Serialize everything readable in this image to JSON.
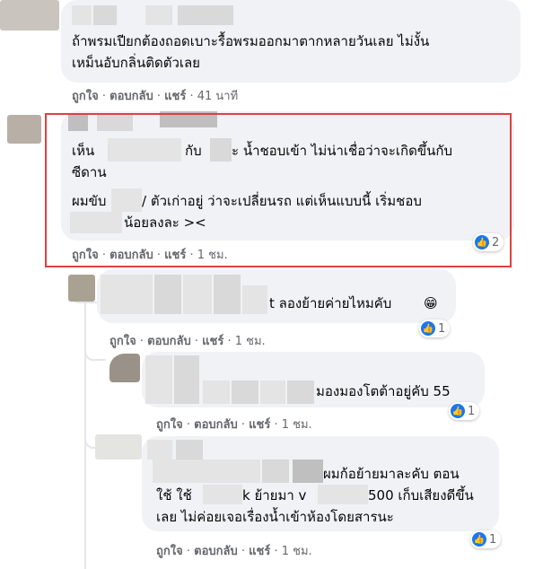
{
  "comments": [
    {
      "lines": [
        "ถ้าพรมเปียกต้องถอดเบาะรื้อพรมออกมาตากหลายวันเลย ไม่งั้น",
        "เหม็นอับกลิ่นติดตัวเลย"
      ],
      "actions": {
        "like": "ถูกใจ",
        "reply": "ตอบกลับ",
        "share": "แชร์",
        "time": "41 นาที"
      }
    },
    {
      "lines_p1": [
        "เห็น",
        "กับ",
        "ะ น้ำชอบเข้า ไม่น่าเชื่อว่าจะเกิดขึ้นกับ",
        "ซีดาน"
      ],
      "lines_p2": [
        "ผมขับ",
        "/ ตัวเก่าอยู่ ว่าจะเปลี่ยนรถ แต่เห็นแบบนี้ เริ่มชอบ",
        "น้อยลงละ ><"
      ],
      "actions": {
        "like": "ถูกใจ",
        "reply": "ตอบกลับ",
        "share": "แชร์",
        "time": "1 ชม."
      },
      "reactions": {
        "icon": "like-icon",
        "count": "2"
      }
    },
    {
      "lines": [
        "t ลองย้ายค่ายไหมคับ"
      ],
      "emoji": "😁",
      "actions": {
        "like": "ถูกใจ",
        "reply": "ตอบกลับ",
        "share": "แชร์",
        "time": "1 ชม."
      },
      "reactions": {
        "icon": "like-icon",
        "count": "1"
      }
    },
    {
      "lines": [
        "มองมองโตต้าอยู่คับ 55"
      ],
      "actions": {
        "like": "ถูกใจ",
        "reply": "ตอบกลับ",
        "share": "แชร์",
        "time": "1 ชม."
      },
      "reactions": {
        "icon": "like-icon",
        "count": "1"
      }
    },
    {
      "lines": [
        "ผมก้อย้ายมาละคับ ตอน",
        "ใช้ ใช้",
        "k ย้ายมา v",
        "500 เก็บเสียงดีขึ้น",
        "เลย ไม่ค่อยเจอเรื่องน้ำเข้าห้องโดยสารนะ"
      ],
      "actions": {
        "like": "ถูกใจ",
        "reply": "ตอบกลับ",
        "share": "แชร์",
        "time": "1 ชม."
      },
      "reactions": {
        "icon": "like-icon",
        "count": "1"
      }
    }
  ],
  "colors": {
    "bubble": "#f0f2f5",
    "highlight": "#e0413d",
    "like": "#1877f2",
    "meta": "#65676b"
  }
}
